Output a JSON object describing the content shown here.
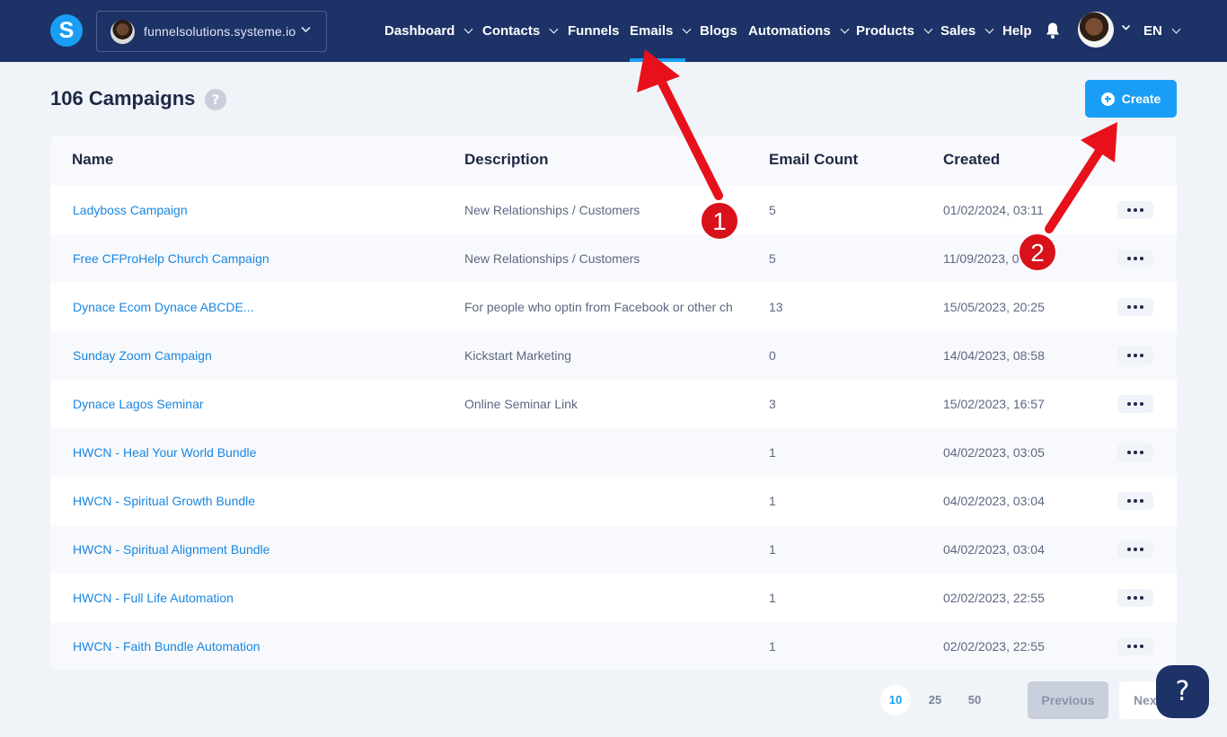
{
  "brand": {
    "logo_letter": "S",
    "accent": "#1a9ef5",
    "nav_bg": "#1d3267"
  },
  "workspace": {
    "name": "funnelsolutions.systeme.io"
  },
  "nav": {
    "dashboard": "Dashboard",
    "contacts": "Contacts",
    "funnels": "Funnels",
    "emails": "Emails",
    "blogs": "Blogs",
    "automations": "Automations",
    "products": "Products",
    "sales": "Sales",
    "help": "Help",
    "active": "Emails"
  },
  "language": "EN",
  "header": {
    "title": "106 Campaigns",
    "help_badge": "?",
    "create_label": "Create"
  },
  "table": {
    "columns": [
      "Name",
      "Description",
      "Email Count",
      "Created"
    ],
    "rows": [
      {
        "name": "Ladyboss Campaign",
        "description": "New Relationships / Customers",
        "email_count": "5",
        "created": "01/02/2024, 03:11"
      },
      {
        "name": "Free CFProHelp Church Campaign",
        "description": "New Relationships / Customers",
        "email_count": "5",
        "created": "11/09/2023, 03:"
      },
      {
        "name": "Dynace Ecom Dynace ABCDE...",
        "description": "For people who optin from Facebook or other ch",
        "email_count": "13",
        "created": "15/05/2023, 20:25"
      },
      {
        "name": "Sunday Zoom Campaign",
        "description": "Kickstart Marketing",
        "email_count": "0",
        "created": "14/04/2023, 08:58"
      },
      {
        "name": "Dynace Lagos Seminar",
        "description": "Online Seminar Link",
        "email_count": "3",
        "created": "15/02/2023, 16:57"
      },
      {
        "name": "HWCN - Heal Your World Bundle",
        "description": "",
        "email_count": "1",
        "created": "04/02/2023, 03:05"
      },
      {
        "name": "HWCN - Spiritual Growth Bundle",
        "description": "",
        "email_count": "1",
        "created": "04/02/2023, 03:04"
      },
      {
        "name": "HWCN - Spiritual Alignment Bundle",
        "description": "",
        "email_count": "1",
        "created": "04/02/2023, 03:04"
      },
      {
        "name": "HWCN - Full Life Automation",
        "description": "",
        "email_count": "1",
        "created": "02/02/2023, 22:55"
      },
      {
        "name": "HWCN - Faith Bundle Automation",
        "description": "",
        "email_count": "1",
        "created": "02/02/2023, 22:55"
      }
    ]
  },
  "pagination": {
    "page_sizes": [
      "10",
      "25",
      "50"
    ],
    "selected": "10",
    "previous": "Previous",
    "next": "Next"
  },
  "support": {
    "label": "?"
  },
  "annotations": {
    "marker_1": "1",
    "marker_2": "2",
    "arrow_color": "#e8101a"
  }
}
